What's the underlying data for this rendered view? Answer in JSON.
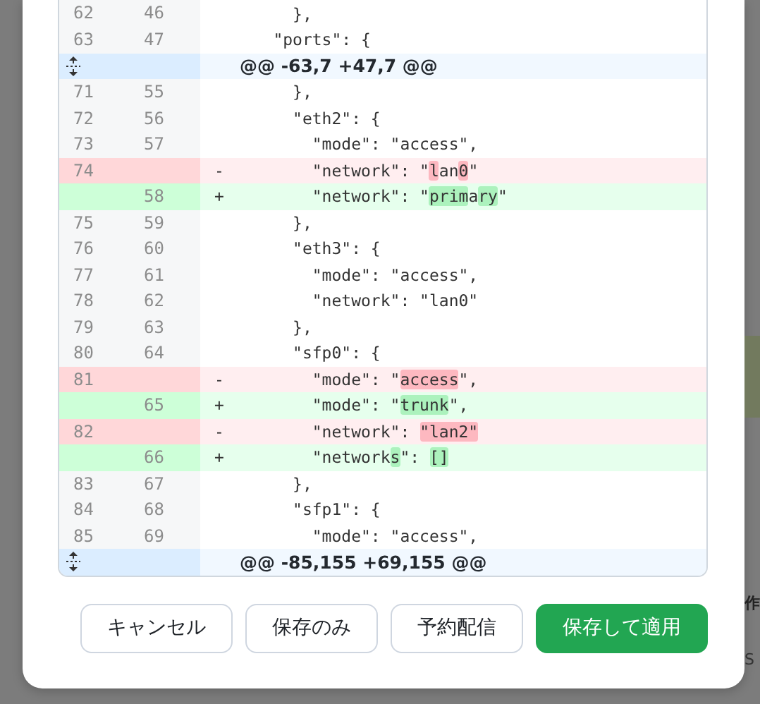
{
  "diff": {
    "lines": [
      {
        "kind": "context",
        "old": "62",
        "new": "46",
        "parts": [
          {
            "text": "      },",
            "highlight": false
          }
        ]
      },
      {
        "kind": "context",
        "old": "63",
        "new": "47",
        "parts": [
          {
            "text": "    \"ports\": {",
            "highlight": false
          }
        ]
      },
      {
        "kind": "hunk",
        "header": "@@ -63,7 +47,7 @@"
      },
      {
        "kind": "context",
        "old": "71",
        "new": "55",
        "parts": [
          {
            "text": "      },",
            "highlight": false
          }
        ]
      },
      {
        "kind": "context",
        "old": "72",
        "new": "56",
        "parts": [
          {
            "text": "      \"eth2\": {",
            "highlight": false
          }
        ]
      },
      {
        "kind": "context",
        "old": "73",
        "new": "57",
        "parts": [
          {
            "text": "        \"mode\": \"access\",",
            "highlight": false
          }
        ]
      },
      {
        "kind": "deleted",
        "old": "74",
        "sign": "-",
        "parts": [
          {
            "text": "        \"network\": \"",
            "highlight": false
          },
          {
            "text": "l",
            "highlight": true
          },
          {
            "text": "an",
            "highlight": false
          },
          {
            "text": "0",
            "highlight": true
          },
          {
            "text": "\"",
            "highlight": false
          }
        ]
      },
      {
        "kind": "added",
        "new": "58",
        "sign": "+",
        "parts": [
          {
            "text": "        \"network\": \"",
            "highlight": false
          },
          {
            "text": "prim",
            "highlight": true
          },
          {
            "text": "a",
            "highlight": false
          },
          {
            "text": "ry",
            "highlight": true
          },
          {
            "text": "\"",
            "highlight": false
          }
        ]
      },
      {
        "kind": "context",
        "old": "75",
        "new": "59",
        "parts": [
          {
            "text": "      },",
            "highlight": false
          }
        ]
      },
      {
        "kind": "context",
        "old": "76",
        "new": "60",
        "parts": [
          {
            "text": "      \"eth3\": {",
            "highlight": false
          }
        ]
      },
      {
        "kind": "context",
        "old": "77",
        "new": "61",
        "parts": [
          {
            "text": "        \"mode\": \"access\",",
            "highlight": false
          }
        ]
      },
      {
        "kind": "context",
        "old": "78",
        "new": "62",
        "parts": [
          {
            "text": "        \"network\": \"lan0\"",
            "highlight": false
          }
        ]
      },
      {
        "kind": "context",
        "old": "79",
        "new": "63",
        "parts": [
          {
            "text": "      },",
            "highlight": false
          }
        ]
      },
      {
        "kind": "context",
        "old": "80",
        "new": "64",
        "parts": [
          {
            "text": "      \"sfp0\": {",
            "highlight": false
          }
        ]
      },
      {
        "kind": "deleted",
        "old": "81",
        "sign": "-",
        "parts": [
          {
            "text": "        \"mode\": \"",
            "highlight": false
          },
          {
            "text": "access",
            "highlight": true
          },
          {
            "text": "\",",
            "highlight": false
          }
        ]
      },
      {
        "kind": "added",
        "new": "65",
        "sign": "+",
        "parts": [
          {
            "text": "        \"mode\": \"",
            "highlight": false
          },
          {
            "text": "trunk",
            "highlight": true
          },
          {
            "text": "\",",
            "highlight": false
          }
        ]
      },
      {
        "kind": "deleted",
        "old": "82",
        "sign": "-",
        "parts": [
          {
            "text": "        \"network\": ",
            "highlight": false
          },
          {
            "text": "\"lan2\"",
            "highlight": true
          }
        ]
      },
      {
        "kind": "added",
        "new": "66",
        "sign": "+",
        "parts": [
          {
            "text": "        \"network",
            "highlight": false
          },
          {
            "text": "s",
            "highlight": true
          },
          {
            "text": "\": ",
            "highlight": false
          },
          {
            "text": "[]",
            "highlight": true
          }
        ]
      },
      {
        "kind": "context",
        "old": "83",
        "new": "67",
        "parts": [
          {
            "text": "      },",
            "highlight": false
          }
        ]
      },
      {
        "kind": "context",
        "old": "84",
        "new": "68",
        "parts": [
          {
            "text": "      \"sfp1\": {",
            "highlight": false
          }
        ]
      },
      {
        "kind": "context",
        "old": "85",
        "new": "69",
        "parts": [
          {
            "text": "        \"mode\": \"access\",",
            "highlight": false
          }
        ]
      },
      {
        "kind": "hunk",
        "header": "@@ -85,155 +69,155 @@"
      }
    ]
  },
  "buttons": [
    {
      "label": "キャンセル",
      "kind": "secondary"
    },
    {
      "label": "保存のみ",
      "kind": "secondary"
    },
    {
      "label": "予約配信",
      "kind": "secondary"
    },
    {
      "label": "保存して適用",
      "kind": "primary"
    }
  ],
  "background_page": {
    "texts": [
      "作",
      "S"
    ]
  }
}
